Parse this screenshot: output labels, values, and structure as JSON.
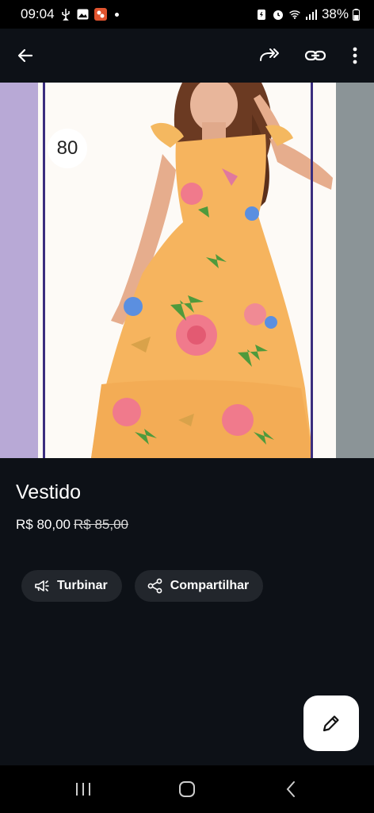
{
  "status_bar": {
    "time": "09:04",
    "battery": "38%"
  },
  "toolbar": {
    "back_icon": "arrow-left-icon",
    "share_icon": "forward-icon",
    "link_icon": "link-icon",
    "more_icon": "more-vertical-icon"
  },
  "media": {
    "size_badge": "80",
    "image": "product-photo-floral-dress"
  },
  "product": {
    "title": "Vestido",
    "price": "R$ 80,00",
    "old_price": "R$ 85,00"
  },
  "actions": {
    "boost_label": "Turbinar",
    "share_label": "Compartilhar"
  },
  "fab": {
    "icon": "pencil-icon"
  },
  "colors": {
    "background": "#0d1117",
    "chip": "#22262c",
    "dress": "#f6b45e"
  }
}
